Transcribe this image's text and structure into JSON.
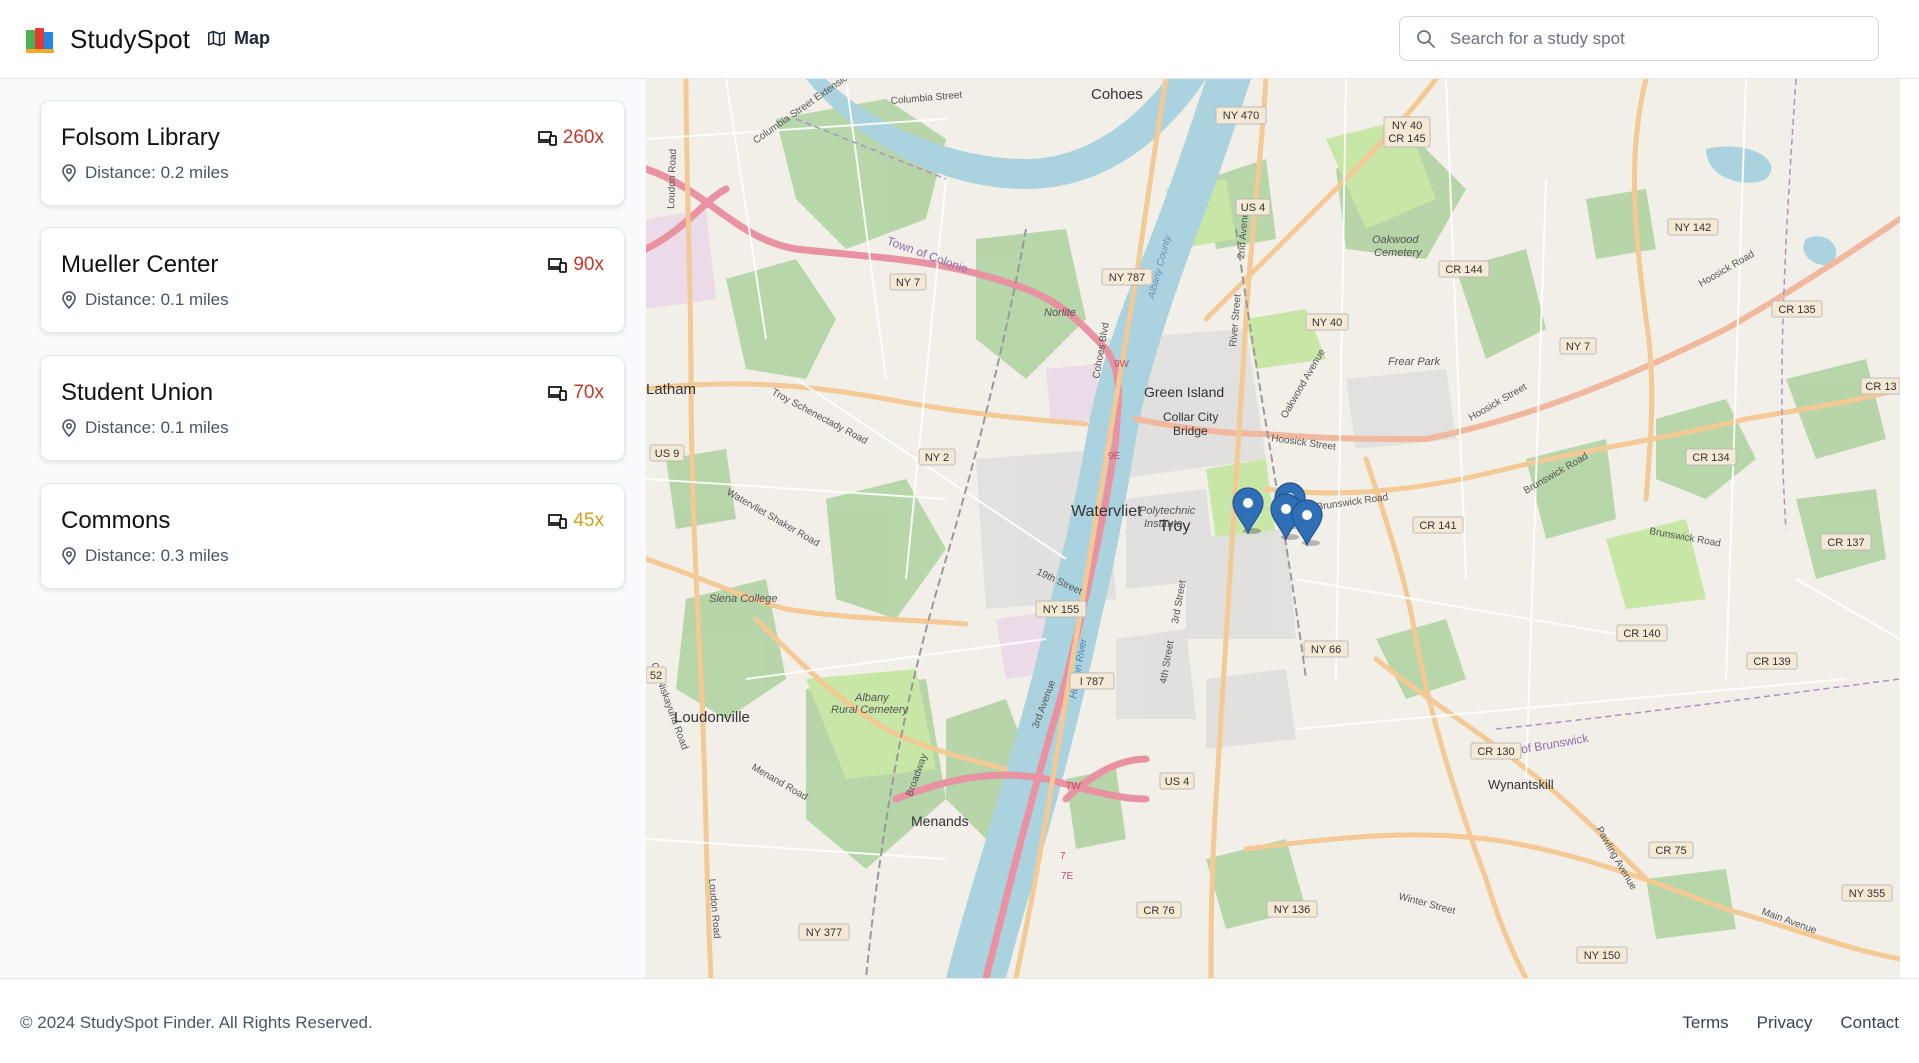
{
  "header": {
    "brand": "StudySpot",
    "nav_map_label": "Map",
    "search_placeholder": "Search for a study spot"
  },
  "spots": [
    {
      "name": "Folsom Library",
      "distance": "Distance: 0.2 miles",
      "count": "260x",
      "count_color": "#c0392b"
    },
    {
      "name": "Mueller Center",
      "distance": "Distance: 0.1 miles",
      "count": "90x",
      "count_color": "#c0392b"
    },
    {
      "name": "Student Union",
      "distance": "Distance: 0.1 miles",
      "count": "70x",
      "count_color": "#c0392b"
    },
    {
      "name": "Commons",
      "distance": "Distance: 0.3 miles",
      "count": "45x",
      "count_color": "#d4a017"
    }
  ],
  "map": {
    "places": {
      "cohoes": "Cohoes",
      "latham": "Latham",
      "green_island": "Green Island",
      "collar_city_1": "Collar City",
      "collar_city_2": "Bridge",
      "watervliet": "Watervliet",
      "troy": "Troy",
      "loudonville": "Loudonville",
      "menands": "Menands",
      "wynantskill": "Wynantskill",
      "norlite": "Norlite",
      "siena": "Siena College",
      "oakwood_1": "Oakwood",
      "oakwood_2": "Cemetery",
      "frear_park": "Frear Park",
      "albany_1": "Albany",
      "albany_2": "Rural Cemetery",
      "rpi_1": "Polytechnic",
      "rpi_2": "Institute",
      "colonie": "Town of Colonie",
      "brunswick_town": "Town of Brunswick"
    },
    "shields": {
      "ny470": "NY 470",
      "ny40_top_1": "NY 40",
      "ny40_top_2": "CR 145",
      "us4_top": "US 4",
      "ny7_left": "NY 7",
      "ny787": "NY 787",
      "ny40_mid": "NY 40",
      "ny142": "NY 142",
      "cr144": "CR 144",
      "cr135": "CR 135",
      "ny7_right": "NY 7",
      "cr13x": "CR 13",
      "us9": "US 9",
      "ny2": "NY 2",
      "cr134": "CR 134",
      "cr141": "CR 141",
      "cr137": "CR 137",
      "ny155": "NY 155",
      "ny66": "NY 66",
      "cr140": "CR 140",
      "cr139": "CR 139",
      "i787": "I 787",
      "cr130": "CR 130",
      "us4_bottom": "US 4",
      "cr75": "CR 75",
      "ny355": "NY 355",
      "cr76": "CR 76",
      "ny136": "NY 136",
      "ny377": "NY 377",
      "ny150": "NY 150",
      "n52": "52"
    },
    "roads": {
      "columbia": "Columbia Street",
      "colonie_ext": "Columbia Street Extension",
      "troy_schenectady": "Troy Schenectady Road",
      "watervliet_shaker": "Watervliet Shaker Road",
      "loudon_top": "Loudon Road",
      "loudon_bottom": "Loudon Road",
      "hoosick_1": "Hoosick Street",
      "hoosick_2": "Hoosick Street",
      "hoosick_3": "Hoosick Road",
      "brunswick_rd_1": "Brunswick Road",
      "brunswick_rd_2": "Brunswick Road",
      "brunswick_rd_3": "Brunswick Road",
      "oakwood_ave": "Oakwood Avenue",
      "river_st": "River Street",
      "second_ave": "2nd Avenue",
      "third_st": "3rd Street",
      "fourth_st": "4th Street",
      "third_ave": "3rd Avenue",
      "broadway": "Broadway",
      "menand_rd": "Menand Road",
      "old_niskayuna": "Old Niskayuna Road",
      "pawling_ave": "Pawling Avenue",
      "main_ave": "Main Avenue",
      "winter_st": "Winter Street",
      "albany_county": "Albany County",
      "hudson": "Hudson River",
      "n19th": "19th Street",
      "cohoes_blvd": "Cohoes Blvd",
      "exit9w": "9W",
      "exit9e": "9E",
      "exit7w": "7W",
      "exit7e": "7E",
      "exit7": "7"
    }
  },
  "footer": {
    "copyright": "© 2024 StudySpot Finder. All Rights Reserved.",
    "links": [
      "Terms",
      "Privacy",
      "Contact"
    ]
  }
}
